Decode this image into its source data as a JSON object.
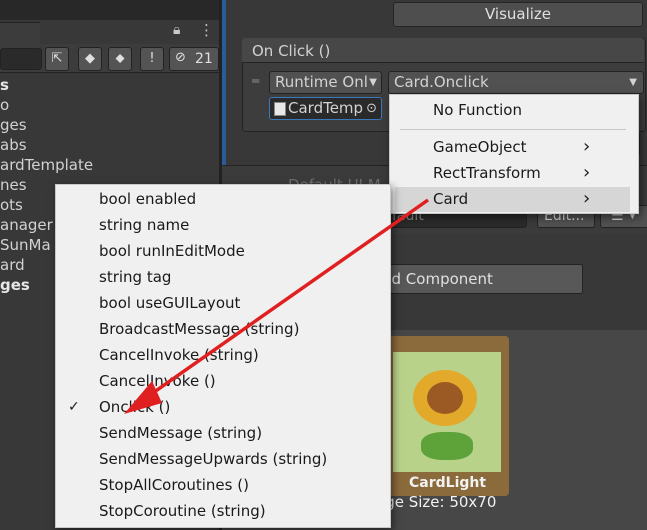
{
  "hierarchy": {
    "badge_count": "21",
    "items": [
      {
        "label": "s",
        "bold": true
      },
      {
        "label": "o",
        "bold": false
      },
      {
        "label": "ges",
        "bold": false
      },
      {
        "label": "abs",
        "bold": false
      },
      {
        "label": "ardTemplate",
        "bold": false
      },
      {
        "label": "nes",
        "bold": false
      },
      {
        "label": "ots",
        "bold": false
      },
      {
        "label": "anager",
        "bold": false
      },
      {
        "label": "SunMa",
        "bold": false
      },
      {
        "label": "ard",
        "bold": false
      },
      {
        "label": "ges",
        "bold": true
      }
    ]
  },
  "inspector": {
    "visualize_label": "Visualize",
    "event_title": "On Click ()",
    "runtime_value": "Runtime Onl",
    "method_value": "Card.Onclick",
    "object_value": "CardTemp",
    "minus_label": "−",
    "section_label": "Default UI M",
    "default_field": "fault",
    "edit_label": "Edit...",
    "add_component_label": "dd Component",
    "card_label": "CardLight",
    "card_size": "age Size: 50x70"
  },
  "menu_primary": {
    "items": [
      {
        "label": "No Function",
        "submenu": false
      },
      {
        "label": "GameObject",
        "submenu": true
      },
      {
        "label": "RectTransform",
        "submenu": true
      },
      {
        "label": "Card",
        "submenu": true
      }
    ]
  },
  "menu_secondary": {
    "items": [
      {
        "label": "bool enabled",
        "checked": false
      },
      {
        "label": "string name",
        "checked": false
      },
      {
        "label": "bool runInEditMode",
        "checked": false
      },
      {
        "label": "string tag",
        "checked": false
      },
      {
        "label": "bool useGUILayout",
        "checked": false
      },
      {
        "label": "BroadcastMessage (string)",
        "checked": false
      },
      {
        "label": "CancelInvoke (string)",
        "checked": false
      },
      {
        "label": "CancelInvoke ()",
        "checked": false
      },
      {
        "label": "Onclick ()",
        "checked": true
      },
      {
        "label": "SendMessage (string)",
        "checked": false
      },
      {
        "label": "SendMessageUpwards (string)",
        "checked": false
      },
      {
        "label": "StopAllCoroutines ()",
        "checked": false
      },
      {
        "label": "StopCoroutine (string)",
        "checked": false
      }
    ]
  },
  "colors": {
    "annotation_arrow": "#e02020",
    "selection_blue": "#3a79bb"
  }
}
